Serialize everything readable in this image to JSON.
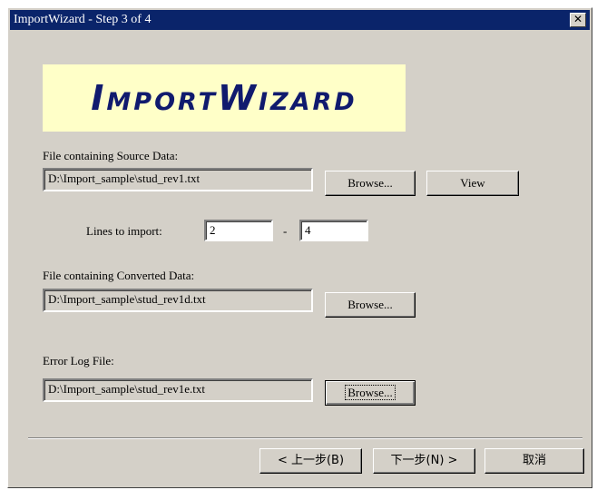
{
  "window": {
    "title": "ImportWizard - Step 3 of 4",
    "close_label": "✕"
  },
  "logo": {
    "text": "ImportWizard"
  },
  "source": {
    "label": "File containing Source Data:",
    "value": "D:\\Import_sample\\stud_rev1.txt",
    "browse_label": "Browse...",
    "view_label": "View"
  },
  "lines": {
    "label": "Lines to import:",
    "from": "2",
    "separator": "-",
    "to": "4"
  },
  "converted": {
    "label": "File containing Converted Data:",
    "value": "D:\\Import_sample\\stud_rev1d.txt",
    "browse_label": "Browse..."
  },
  "errorlog": {
    "label": "Error Log File:",
    "value": "D:\\Import_sample\\stud_rev1e.txt",
    "browse_label": "Browse..."
  },
  "footer": {
    "back_label": "< 上一步(B)",
    "next_label": "下一步(N) >",
    "cancel_label": "取消"
  }
}
